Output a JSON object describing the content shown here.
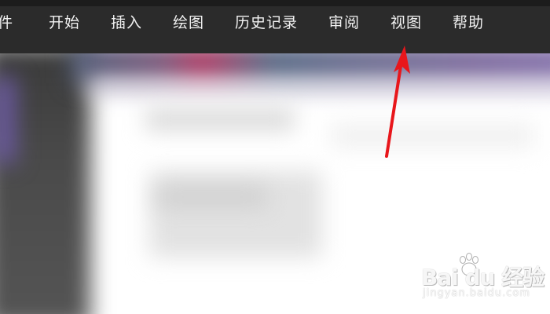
{
  "menubar": {
    "items": [
      {
        "label": "件"
      },
      {
        "label": "开始"
      },
      {
        "label": "插入"
      },
      {
        "label": "绘图"
      },
      {
        "label": "历史记录"
      },
      {
        "label": "审阅"
      },
      {
        "label": "视图"
      },
      {
        "label": "帮助"
      }
    ]
  },
  "annotation": {
    "arrow_color": "#e8161b",
    "points_to": "视图"
  },
  "watermark": {
    "logo_text": "Bai du 经验",
    "url": "jingyan.baidu.com"
  },
  "colors": {
    "menubar_bg": "#2b2b2b",
    "menu_text": "#f2f2f2"
  }
}
